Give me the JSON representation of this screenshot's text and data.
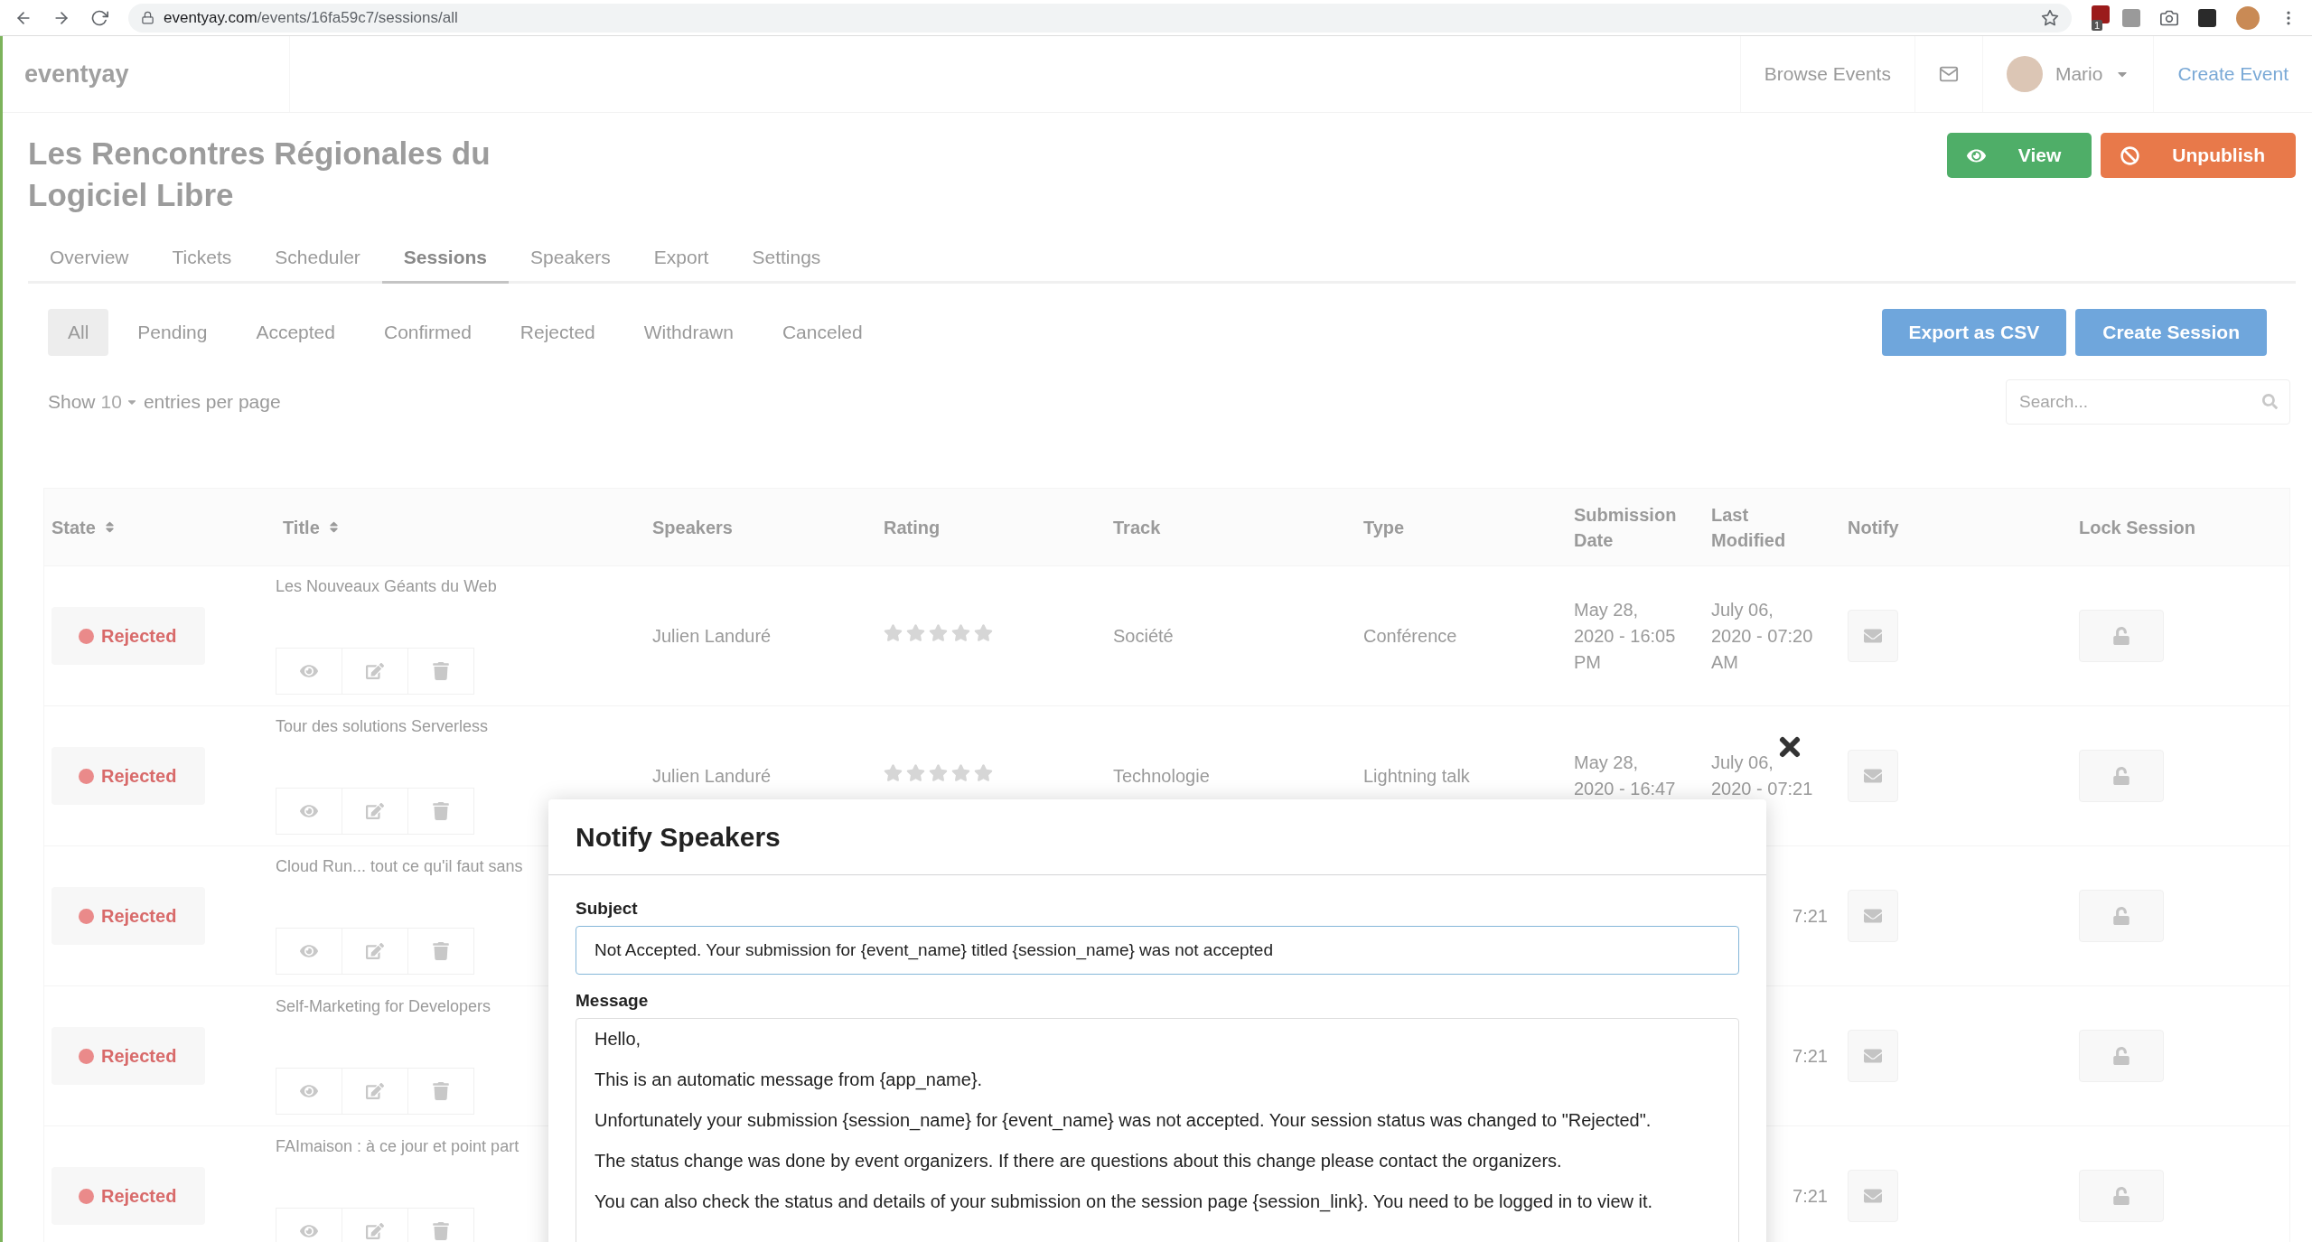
{
  "browser": {
    "url_host": "eventyay.com",
    "url_path": "/events/16fa59c7/sessions/all",
    "extension_badge": "1"
  },
  "navbar": {
    "logo": "eventyay",
    "browse": "Browse Events",
    "user": "Mario",
    "create_event": "Create Event"
  },
  "event": {
    "title": "Les Rencontres Régionales du Logiciel Libre",
    "buttons": [
      {
        "label": "View",
        "kind": "view"
      },
      {
        "label": "Unpublish",
        "kind": "unpublish"
      }
    ]
  },
  "tabs": [
    {
      "label": "Overview",
      "selected": false
    },
    {
      "label": "Tickets",
      "selected": false
    },
    {
      "label": "Scheduler",
      "selected": false
    },
    {
      "label": "Sessions",
      "selected": true
    },
    {
      "label": "Speakers",
      "selected": false
    },
    {
      "label": "Export",
      "selected": false
    },
    {
      "label": "Settings",
      "selected": false
    }
  ],
  "filters": [
    {
      "label": "All",
      "selected": true
    },
    {
      "label": "Pending",
      "selected": false
    },
    {
      "label": "Accepted",
      "selected": false
    },
    {
      "label": "Confirmed",
      "selected": false
    },
    {
      "label": "Rejected",
      "selected": false
    },
    {
      "label": "Withdrawn",
      "selected": false
    },
    {
      "label": "Canceled",
      "selected": false
    }
  ],
  "actions": [
    "Export as CSV",
    "Create Session"
  ],
  "entries": {
    "prefix": "Show",
    "value": "10",
    "suffix": "entries per page"
  },
  "search": {
    "placeholder": "Search..."
  },
  "table": {
    "columns": [
      {
        "label": "State",
        "sortable": true
      },
      {
        "label": "Title",
        "sortable": true
      },
      {
        "label": "Speakers",
        "sortable": false
      },
      {
        "label": "Rating",
        "sortable": false
      },
      {
        "label": "Track",
        "sortable": false
      },
      {
        "label": "Type",
        "sortable": false
      },
      {
        "label": "Submission Date",
        "sortable": false
      },
      {
        "label": "Last Modified",
        "sortable": false
      },
      {
        "label": "Notify",
        "sortable": false
      },
      {
        "label": "Lock Session",
        "sortable": false
      }
    ],
    "rows": [
      {
        "kind": "full",
        "state": "Rejected",
        "title": "Les Nouveaux Géants du Web",
        "speakers": "Julien Landuré",
        "stars": 0,
        "track": "Société",
        "type": "Conférence",
        "submitted": "May 28, 2020 - 16:05 PM",
        "modified": "July 06, 2020 - 07:20 AM"
      },
      {
        "kind": "full",
        "state": "Rejected",
        "title": "Tour des solutions Serverless",
        "speakers": "Julien Landuré",
        "stars": 0,
        "track": "Technologie",
        "type": "Lightning talk",
        "submitted": "May 28, 2020 - 16:47",
        "modified": "July 06, 2020 - 07:21"
      },
      {
        "kind": "partial",
        "state": "Rejected",
        "title": "Cloud Run... tout ce qu'il faut sans",
        "modified": "7:21"
      },
      {
        "kind": "partial",
        "state": "Rejected",
        "title": "Self-Marketing for Developers",
        "modified": "7:21"
      },
      {
        "kind": "partial",
        "state": "Rejected",
        "title": "FAImaison : à ce jour et point part",
        "modified": "7:21"
      }
    ]
  },
  "modal": {
    "title": "Notify Speakers",
    "subject_label": "Subject",
    "subject": "Not Accepted. Your submission for {event_name} titled {session_name} was not accepted",
    "message_label": "Message",
    "message": [
      "Hello,",
      "This is an automatic message from {app_name}.",
      "Unfortunately your submission {session_name} for {event_name} was not accepted. Your session status was changed to \"Rejected\".",
      "The status change was done by event organizers. If there are questions about this change please contact the organizers.",
      "You can also check the status and details of your submission on the session page {session_link}. You need to be logged in to view it."
    ]
  }
}
